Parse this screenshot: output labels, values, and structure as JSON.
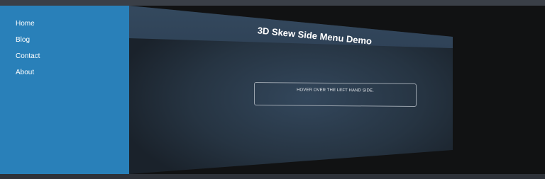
{
  "menu": {
    "items": [
      {
        "label": "Home"
      },
      {
        "label": "Blog"
      },
      {
        "label": "Contact"
      },
      {
        "label": "About"
      }
    ]
  },
  "page": {
    "title": "3D Skew Side Menu Demo",
    "hint": "HOVER OVER THE LEFT HAND SIDE."
  },
  "colors": {
    "menu_bg": "#2980b9",
    "panel_bg": "#2c3e50",
    "page_bg": "#111213"
  }
}
